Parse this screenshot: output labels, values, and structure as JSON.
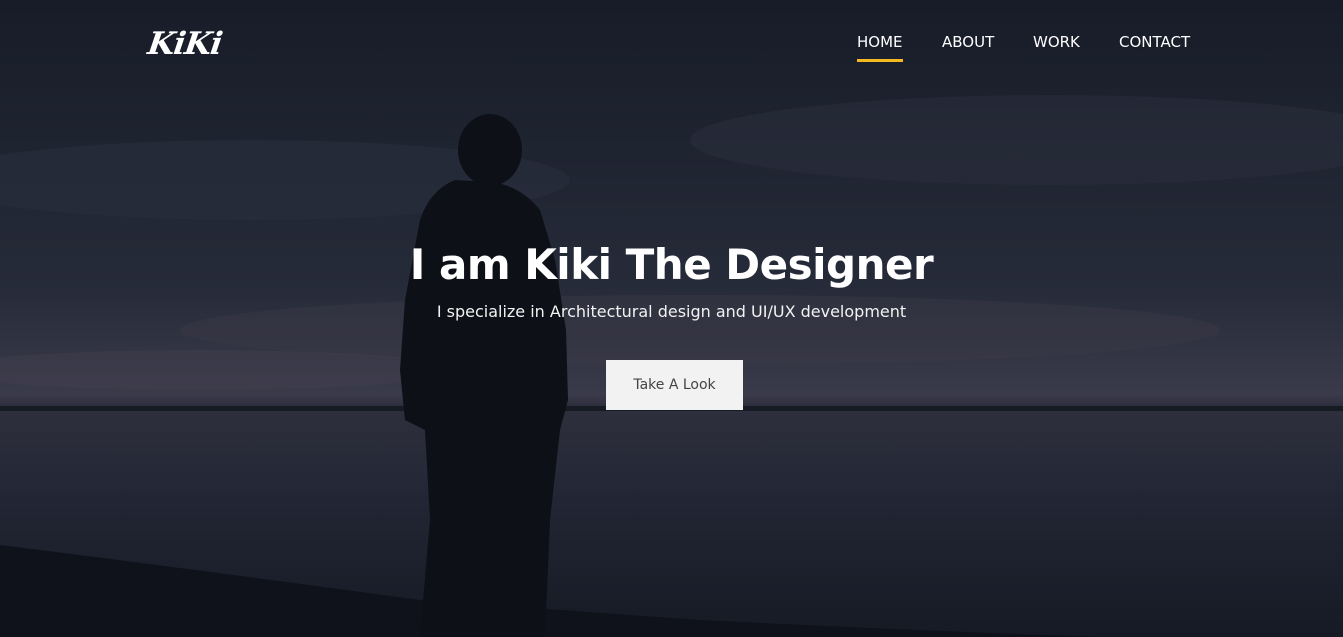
{
  "brand": {
    "logo_text": "KiKi"
  },
  "nav": {
    "items": [
      {
        "label": "HOME",
        "active": true
      },
      {
        "label": "ABOUT",
        "active": false
      },
      {
        "label": "WORK",
        "active": false
      },
      {
        "label": "CONTACT",
        "active": false
      }
    ]
  },
  "hero": {
    "title": "I am Kiki The Designer",
    "subtitle": "I specialize in Architectural design and UI/UX development",
    "cta_label": "Take A Look"
  },
  "colors": {
    "accent": "#f5b921",
    "button_bg": "#f2f2f2",
    "button_text": "#444444",
    "sky_dark": "#1a1f2b",
    "water": "#1d2230"
  }
}
